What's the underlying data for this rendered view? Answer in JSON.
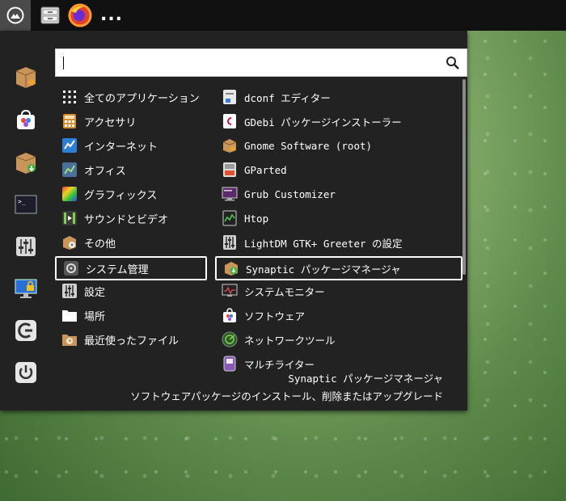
{
  "panel": {
    "menu_icon": "menu-icon",
    "file_manager_icon": "file-manager-icon",
    "firefox_icon": "firefox-icon",
    "more_label": "..."
  },
  "search": {
    "value": "",
    "placeholder": ""
  },
  "favorites": [
    {
      "icon": "package-icon"
    },
    {
      "icon": "software-store-icon"
    },
    {
      "icon": "package-install-icon"
    },
    {
      "icon": "terminal-icon"
    },
    {
      "icon": "mixer-settings-icon"
    },
    {
      "icon": "lock-screen-icon"
    },
    {
      "icon": "logout-icon"
    },
    {
      "icon": "power-icon"
    }
  ],
  "categories": [
    {
      "label": "全てのアプリケーション",
      "icon": "grid-icon"
    },
    {
      "label": "アクセサリ",
      "icon": "calculator-icon"
    },
    {
      "label": "インターネット",
      "icon": "internet-icon"
    },
    {
      "label": "オフィス",
      "icon": "office-icon"
    },
    {
      "label": "グラフィックス",
      "icon": "graphics-icon"
    },
    {
      "label": "サウンドとビデオ",
      "icon": "multimedia-icon"
    },
    {
      "label": "その他",
      "icon": "other-icon"
    },
    {
      "label": "システム管理",
      "icon": "system-admin-icon",
      "selected": true
    },
    {
      "label": "設定",
      "icon": "settings-icon"
    },
    {
      "label": "場所",
      "icon": "folder-icon"
    },
    {
      "label": "最近使ったファイル",
      "icon": "recent-files-icon"
    }
  ],
  "apps": [
    {
      "label": "dconf エディター",
      "icon": "dconf-icon"
    },
    {
      "label": "GDebi パッケージインストーラー",
      "icon": "debian-icon"
    },
    {
      "label": "Gnome Software (root)",
      "icon": "package-icon"
    },
    {
      "label": "GParted",
      "icon": "gparted-icon"
    },
    {
      "label": "Grub Customizer",
      "icon": "grub-icon"
    },
    {
      "label": "Htop",
      "icon": "htop-icon"
    },
    {
      "label": "LightDM GTK+ Greeter の設定",
      "icon": "lightdm-icon"
    },
    {
      "label": "Synaptic パッケージマネージャ",
      "icon": "synaptic-icon",
      "selected": true
    },
    {
      "label": "システムモニター",
      "icon": "system-monitor-icon"
    },
    {
      "label": "ソフトウェア",
      "icon": "software-store-icon"
    },
    {
      "label": "ネットワークツール",
      "icon": "network-tools-icon"
    },
    {
      "label": "マルチライター",
      "icon": "multiwriter-icon"
    }
  ],
  "description": {
    "title": "Synaptic パッケージマネージャ",
    "body": "ソフトウェアパッケージのインストール、削除またはアップグレード"
  },
  "colors": {
    "menu_bg": "#222222",
    "panel_bg": "#111111",
    "selection_border": "#ffffff"
  }
}
